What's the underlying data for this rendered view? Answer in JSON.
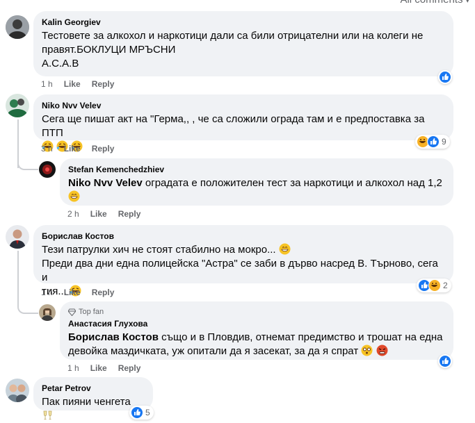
{
  "header": {
    "all_comments_label": "All comments"
  },
  "colors": {
    "bubble": "#f0f2f5",
    "meta": "#65676b",
    "like_blue": "#1877f2",
    "haha_yellow": "#f7b125"
  },
  "comments": [
    {
      "author": "Kalin Georgiev",
      "lines": [
        "Тестовете за алкохол и наркотици дали са били отрицателни или на колеги не",
        "правят.БОКЛУЦИ МРЪСНИ",
        "A.C.A.B"
      ],
      "time": "1 h",
      "like": "Like",
      "reply": "Reply",
      "reactions": [
        "like"
      ],
      "reaction_count": ""
    },
    {
      "author": "Niko Nvv Velev",
      "text": "Сега ще пишат акт на \"Герма,, , че са сложили ограда там и е предпоставка за ПТП",
      "emojis": [
        "rofl",
        "rofl",
        "rofl"
      ],
      "time": "3 h",
      "like": "Like",
      "reply": "Reply",
      "reactions": [
        "haha",
        "like"
      ],
      "reaction_count": "9"
    },
    {
      "author": "Stefan Kemenchedzhiev",
      "mention": "Niko Nvv Velev",
      "text": " оградата е положителен тест за наркотици и алкохол над 1,2",
      "emojis": [
        "grin"
      ],
      "time": "2 h",
      "like": "Like",
      "reply": "Reply"
    },
    {
      "author": "Борислав Костов",
      "line1": "Тези патрулки хич не стоят стабилно на мокро...",
      "line2": "Преди два дни една полицейска \"Астра\" се заби в дърво насред В. Търново, сега и",
      "line3": "тия...",
      "time": "1 h",
      "like": "Like",
      "reply": "Reply",
      "reactions": [
        "like",
        "haha"
      ],
      "reaction_count": "2"
    },
    {
      "badge": "Top fan",
      "author": "Анастасия Глухова",
      "mention": "Борислав Костов",
      "text": " също и в Пловдив, отнемат предимство и трошат на една девойка маздичката, уж опитали да я засекат, за да я спрат",
      "emojis": [
        "woozy",
        "rage"
      ],
      "time": "1 h",
      "like": "Like",
      "reply": "Reply",
      "reactions": [
        "like"
      ],
      "reaction_count": ""
    },
    {
      "author": "Petar Petrov",
      "text": "Пак пияни ченгета",
      "emojis": [
        "cheers"
      ],
      "reactions": [
        "like"
      ],
      "reaction_count": "5"
    }
  ]
}
